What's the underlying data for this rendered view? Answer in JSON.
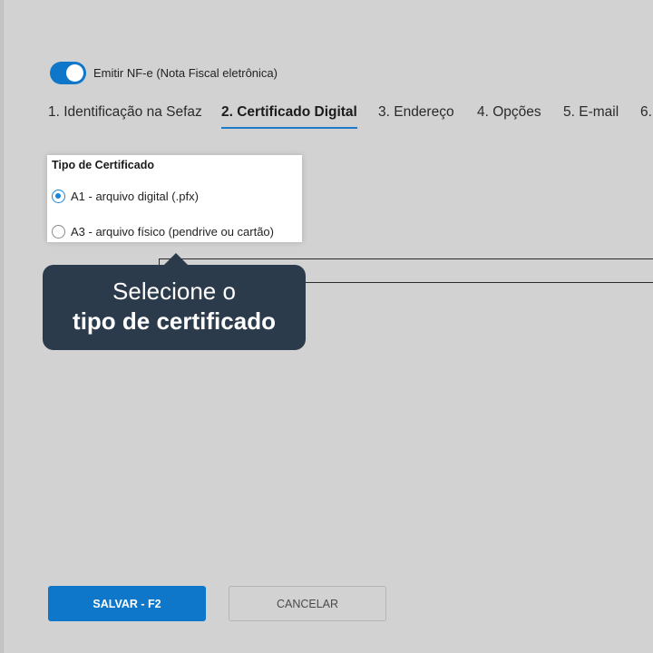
{
  "nfe_toggle": {
    "label": "Emitir NF-e (Nota Fiscal eletrônica)",
    "checked": true
  },
  "tabs": [
    {
      "label": "1. Identificação na Sefaz",
      "active": false
    },
    {
      "label": "2. Certificado Digital",
      "active": true
    },
    {
      "label": "3. Endereço",
      "active": false
    },
    {
      "label": "4. Opções",
      "active": false
    },
    {
      "label": "5. E-mail",
      "active": false
    },
    {
      "label": "6.",
      "active": false
    }
  ],
  "certificate": {
    "title": "Tipo de Certificado",
    "options": [
      {
        "label": "A1 - arquivo digital (.pfx)",
        "selected": true
      },
      {
        "label": "A3 - arquivo físico (pendrive ou cartão)",
        "selected": false
      }
    ]
  },
  "tooltip": {
    "line1": "Selecione o",
    "line2": "tipo de certificado"
  },
  "buttons": {
    "save": "SALVAR - F2",
    "cancel": "CANCELAR"
  },
  "colors": {
    "accent": "#0e77c9",
    "tooltip_bg": "#2c3b4b",
    "background": "#d2d2d2"
  }
}
